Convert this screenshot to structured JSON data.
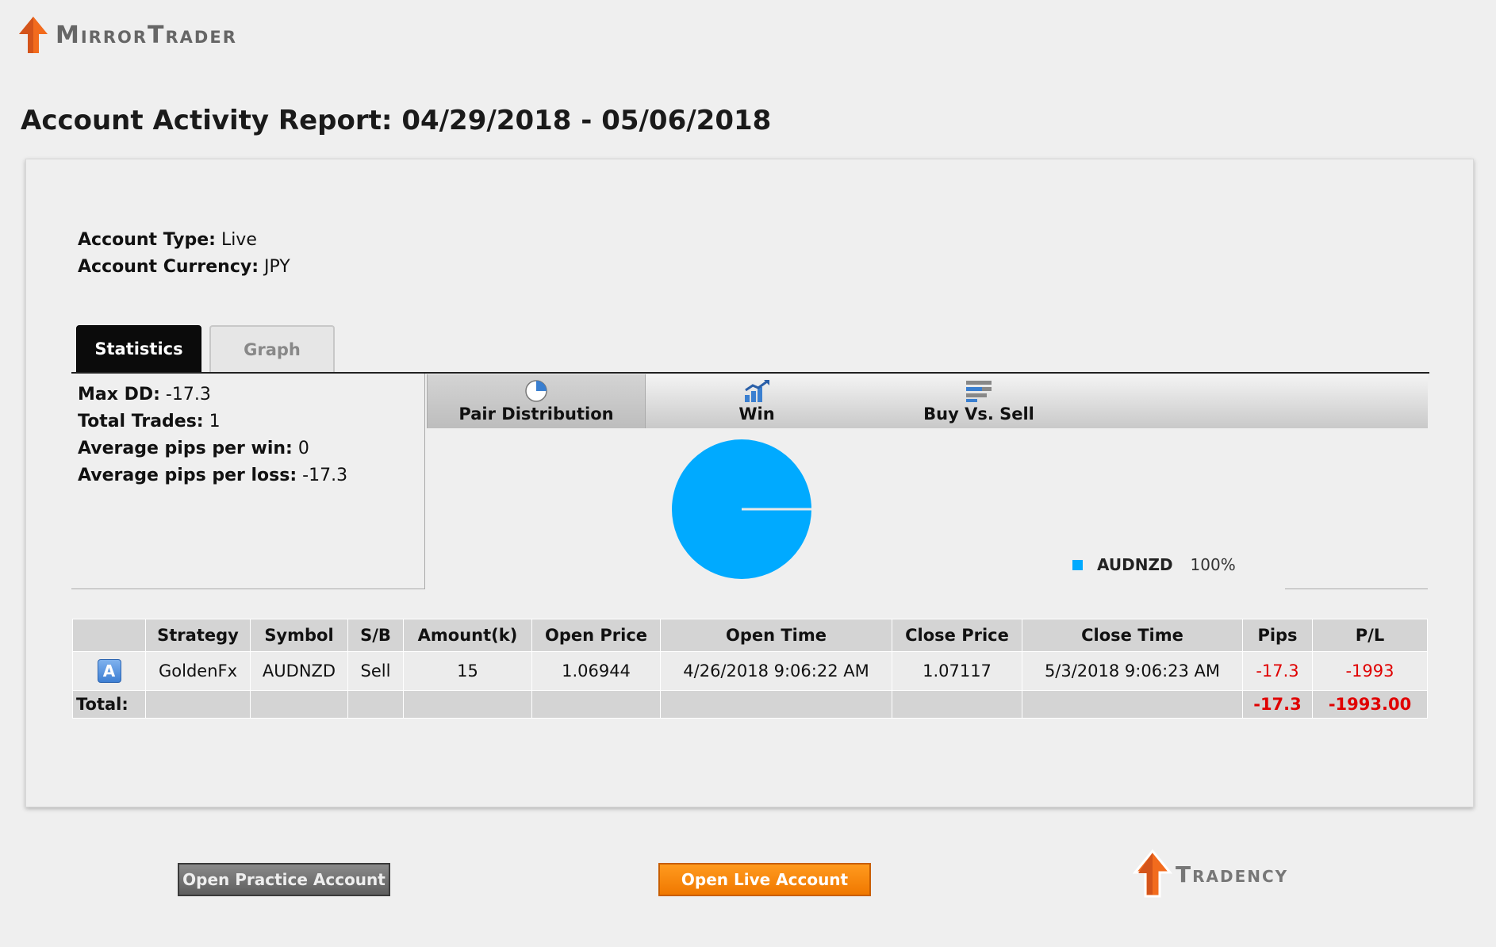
{
  "header": {
    "brand_name": "MirrorTrader",
    "report_title": "Account Activity Report: 04/29/2018 - 05/06/2018"
  },
  "account": {
    "type_label": "Account Type:",
    "type_value": "Live",
    "currency_label": "Account Currency:",
    "currency_value": "JPY"
  },
  "tabs": {
    "statistics": "Statistics",
    "graph": "Graph",
    "active": "statistics"
  },
  "stats": [
    {
      "label": "Max DD:",
      "value": "-17.3"
    },
    {
      "label": "Total Trades:",
      "value": "1"
    },
    {
      "label": "Average pips per win:",
      "value": "0"
    },
    {
      "label": "Average pips per loss:",
      "value": "-17.3"
    }
  ],
  "chart_tabs": {
    "pair_distribution": "Pair Distribution",
    "win": "Win",
    "buy_vs_sell": "Buy Vs. Sell",
    "active": "pair_distribution"
  },
  "chart_data": {
    "type": "pie",
    "series": [
      {
        "name": "AUDNZD",
        "value": 100,
        "label": "100%",
        "color": "#00aaff"
      }
    ],
    "legend_position": "bottom-right"
  },
  "table": {
    "headers": [
      "",
      "Strategy",
      "Symbol",
      "S/B",
      "Amount(k)",
      "Open Price",
      "Open Time",
      "Close Price",
      "Close Time",
      "Pips",
      "P/L"
    ],
    "rows": [
      {
        "badge": "A",
        "strategy": "GoldenFx",
        "symbol": "AUDNZD",
        "side": "Sell",
        "amount": "15",
        "open_price": "1.06944",
        "open_time": "4/26/2018 9:06:22 AM",
        "close_price": "1.07117",
        "close_time": "5/3/2018 9:06:23 AM",
        "pips": "-17.3",
        "pl": "-1993"
      }
    ],
    "total": {
      "label": "Total:",
      "pips": "-17.3",
      "pl": "-1993.00"
    }
  },
  "buttons": {
    "practice": "Open Practice Account",
    "live": "Open Live Account"
  },
  "footer": {
    "brand_name": "Tradency"
  },
  "colors": {
    "accent_orange": "#f07800",
    "negative_red": "#e00000",
    "pie_blue": "#00aaff"
  }
}
